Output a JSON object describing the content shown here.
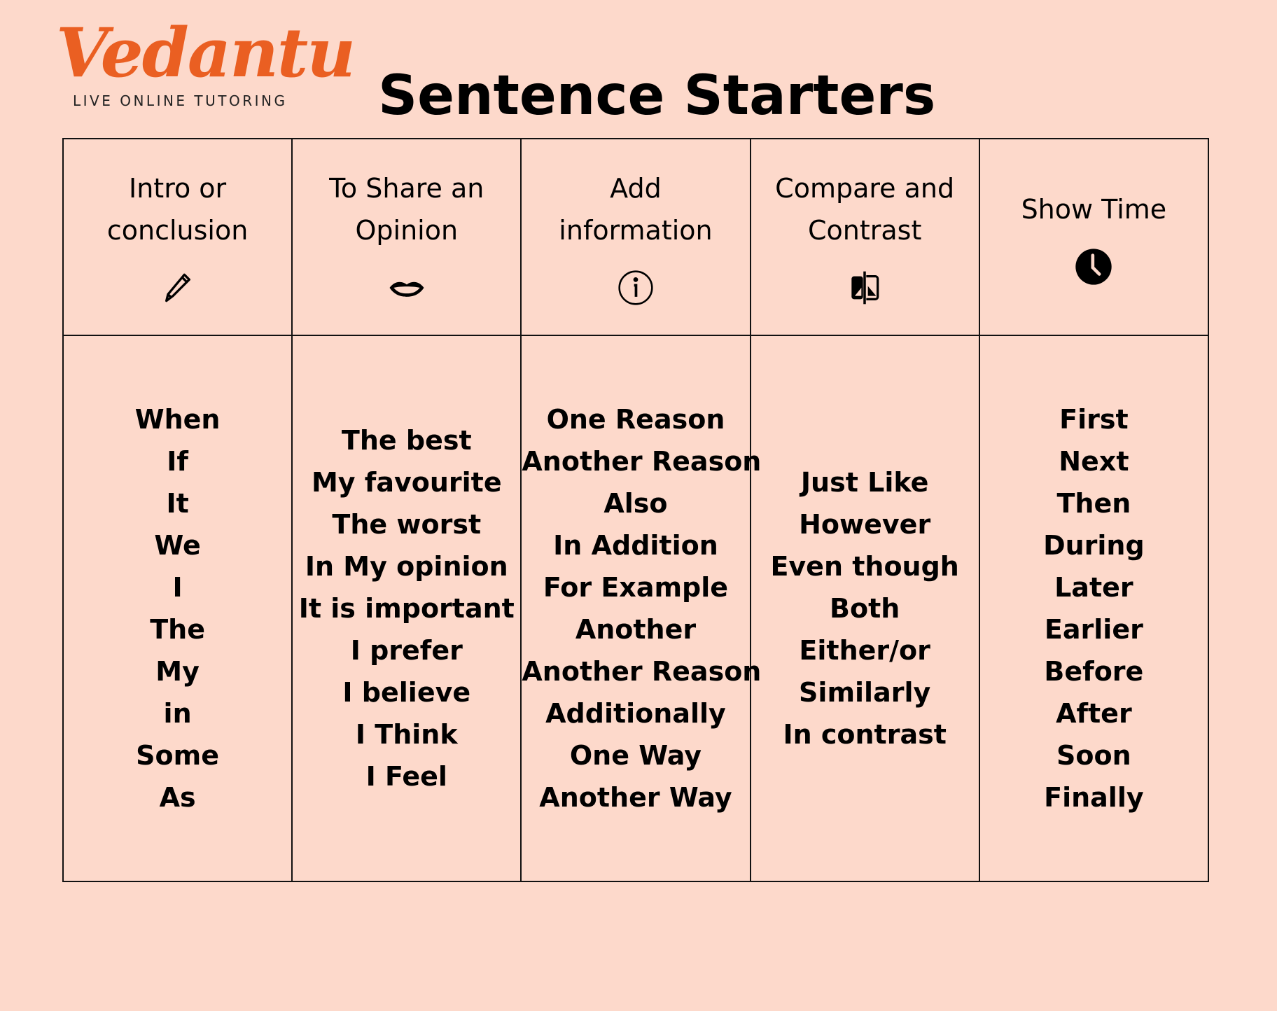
{
  "logo": {
    "wordmark": "Vedantu",
    "tagline": "LIVE ONLINE TUTORING",
    "color": "#ea5f22"
  },
  "title": "Sentence Starters",
  "background_color": "#fdd9cb",
  "columns": [
    {
      "header": "Intro or\nconclusion",
      "icon": "pencil-icon",
      "items": [
        "When",
        "If",
        "It",
        "We",
        "I",
        "The",
        "My",
        "in",
        "Some",
        "As"
      ]
    },
    {
      "header": "To Share an\nOpinion",
      "icon": "lips-icon",
      "items": [
        "The best",
        "My favourite",
        "The worst",
        "In My opinion",
        "It is important",
        "I prefer",
        "I believe",
        "I Think",
        "I Feel"
      ]
    },
    {
      "header": "Add\ninformation",
      "icon": "info-icon",
      "items": [
        "One Reason",
        "Another Reason",
        "Also",
        "In Addition",
        "For Example",
        "Another",
        "Another Reason",
        "Additionally",
        "One Way",
        "Another Way"
      ]
    },
    {
      "header": "Compare and\nContrast",
      "icon": "compare-icon",
      "items": [
        "Just Like",
        "However",
        "Even though",
        "Both",
        "Either/or",
        "Similarly",
        "In contrast"
      ]
    },
    {
      "header": "Show Time",
      "icon": "clock-icon",
      "items": [
        "First",
        "Next",
        "Then",
        "During",
        "Later",
        "Earlier",
        "Before",
        "After",
        "Soon",
        "Finally"
      ]
    }
  ]
}
